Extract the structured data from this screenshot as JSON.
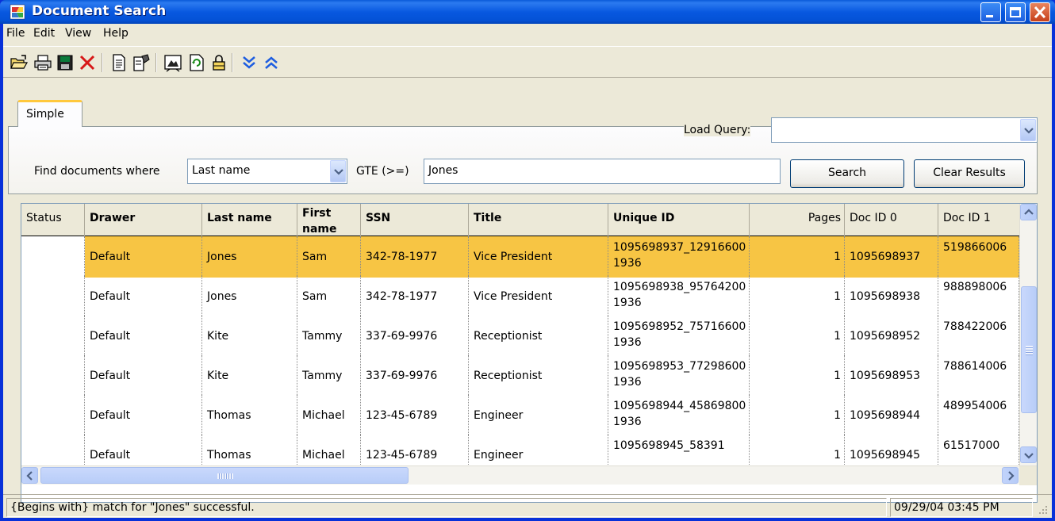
{
  "window": {
    "title": "Document Search"
  },
  "menu": {
    "items": [
      "File",
      "Edit",
      "View",
      "Help"
    ]
  },
  "toolbar": {
    "icons": [
      "open-folder-icon",
      "print-icon",
      "save-icon",
      "delete-icon",
      "document-icon",
      "properties-icon",
      "image-icon",
      "refresh-icon",
      "lock-icon",
      "expand-down-icon",
      "collapse-up-icon"
    ]
  },
  "search": {
    "tab_label": "Simple",
    "load_query_label": "Load Query:",
    "load_query_value": "",
    "find_label": "Find documents where",
    "field_value": "Last name",
    "operator_label": "GTE (>=)",
    "query_value": "Jones",
    "search_button": "Search",
    "clear_button": "Clear Results"
  },
  "grid": {
    "columns": [
      "Status",
      "Drawer",
      "Last name",
      "First name",
      "SSN",
      "Title",
      "Unique ID",
      "Pages",
      "Doc ID 0",
      "Doc ID 1"
    ],
    "rows": [
      {
        "status": "",
        "drawer": "Default",
        "last": "Jones",
        "first": "Sam",
        "ssn": "342-78-1977",
        "title": "Vice President",
        "uid": "1095698937_129166001936",
        "pages": "1",
        "doc0": "1095698937",
        "doc1": "519866006",
        "selected": true
      },
      {
        "status": "",
        "drawer": "Default",
        "last": "Jones",
        "first": "Sam",
        "ssn": "342-78-1977",
        "title": "Vice President",
        "uid": "1095698938_957642001936",
        "pages": "1",
        "doc0": "1095698938",
        "doc1": "988898006",
        "selected": false
      },
      {
        "status": "",
        "drawer": "Default",
        "last": "Kite",
        "first": "Tammy",
        "ssn": "337-69-9976",
        "title": "Receptionist",
        "uid": "1095698952_757166001936",
        "pages": "1",
        "doc0": "1095698952",
        "doc1": "788422006",
        "selected": false
      },
      {
        "status": "",
        "drawer": "Default",
        "last": "Kite",
        "first": "Tammy",
        "ssn": "337-69-9976",
        "title": "Receptionist",
        "uid": "1095698953_772986001936",
        "pages": "1",
        "doc0": "1095698953",
        "doc1": "788614006",
        "selected": false
      },
      {
        "status": "",
        "drawer": "Default",
        "last": "Thomas",
        "first": "Michael",
        "ssn": "123-45-6789",
        "title": "Engineer",
        "uid": "1095698944_458698001936",
        "pages": "1",
        "doc0": "1095698944",
        "doc1": "489954006",
        "selected": false
      },
      {
        "status": "",
        "drawer": "Default",
        "last": "Thomas",
        "first": "Michael",
        "ssn": "123-45-6789",
        "title": "Engineer",
        "uid": "1095698945_58391",
        "pages": "1",
        "doc0": "1095698945",
        "doc1": "61517000",
        "selected": false
      }
    ]
  },
  "statusbar": {
    "message": "{Begins with} match for \"Jones\" successful.",
    "datetime": "09/29/04 03:45 PM"
  },
  "colors": {
    "title_bar": "#0858e0",
    "selected_row": "#f7c544",
    "tab_accent": "#ffc83c"
  }
}
